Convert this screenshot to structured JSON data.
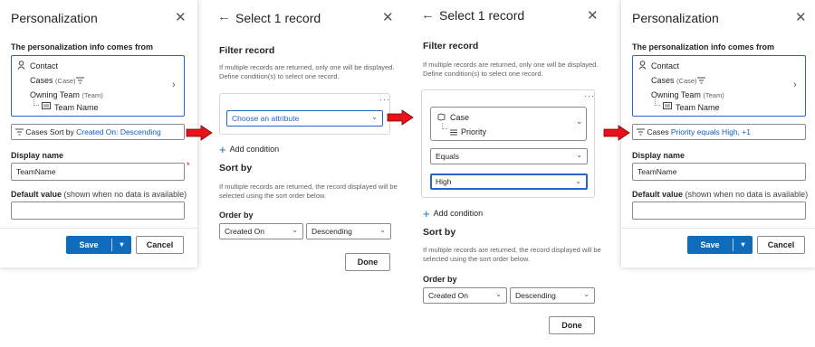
{
  "panel1": {
    "title": "Personalization",
    "source_label": "The personalization info comes from",
    "source": {
      "contact": "Contact",
      "cases": "Cases",
      "cases_tag": "(Case)",
      "owning_team": "Owning Team",
      "owning_team_tag": "(Team)",
      "team_name": "Team Name"
    },
    "sort_prefix": "Cases",
    "sort_by": "Sort by",
    "sort_link": "Created On: Descending",
    "display_name_label": "Display name",
    "display_name_value": "TeamName",
    "default_value_label": "Default value",
    "default_value_hint": "(shown when no data is available)",
    "save": "Save",
    "cancel": "Cancel"
  },
  "panel2": {
    "title": "Select 1 record",
    "filter_heading": "Filter record",
    "filter_help": "If multiple records are returned, only one will be displayed. Define condition(s) to select one record.",
    "attribute_placeholder": "Choose an attribute",
    "add_condition": "Add condition",
    "sort_heading": "Sort by",
    "sort_help": "If multiple records are returned, the record displayed will be selected using the sort order below.",
    "order_label": "Order by",
    "order_field": "Created On",
    "order_dir": "Descending",
    "done": "Done"
  },
  "panel3": {
    "title": "Select 1 record",
    "filter_heading": "Filter record",
    "filter_help": "If multiple records are returned, only one will be displayed. Define condition(s) to select one record.",
    "condition_entity": "Case",
    "condition_attr": "Priority",
    "operator": "Equals",
    "value": "High",
    "add_condition": "Add condition",
    "sort_heading": "Sort by",
    "sort_help": "If multiple records are returned, the record displayed will be selected using the sort order below.",
    "order_label": "Order by",
    "order_field": "Created On",
    "order_dir": "Descending",
    "done": "Done"
  },
  "panel4": {
    "title": "Personalization",
    "source_label": "The personalization info comes from",
    "source": {
      "contact": "Contact",
      "cases": "Cases",
      "cases_tag": "(Case)",
      "owning_team": "Owning Team",
      "owning_team_tag": "(Team)",
      "team_name": "Team Name"
    },
    "sort_prefix": "Cases",
    "sort_link": "Priority equals High, +1",
    "display_name_label": "Display name",
    "display_name_value": "TeamName",
    "default_value_label": "Default value",
    "default_value_hint": "(shown when no data is available)",
    "save": "Save",
    "cancel": "Cancel"
  },
  "colors": {
    "accent": "#0f6cbd",
    "arrow": "#e8121d",
    "focus": "#2b63c9"
  },
  "icons": [
    "close-icon",
    "back-arrow-icon",
    "person-icon",
    "filter-icon",
    "table-icon",
    "chevron-right-icon",
    "chevron-down-icon",
    "plus-icon",
    "more-icon",
    "entity-icon",
    "list-icon",
    "red-arrow-icon"
  ]
}
